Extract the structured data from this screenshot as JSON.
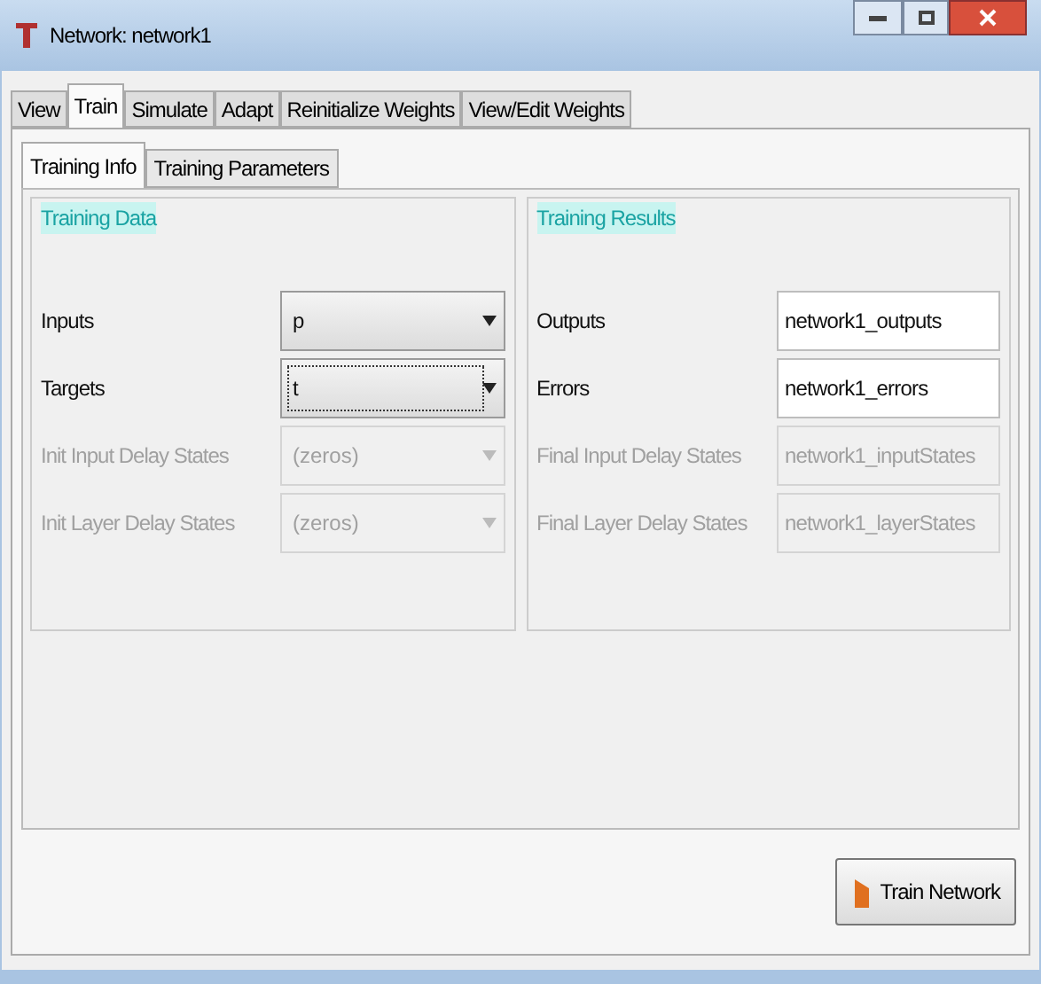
{
  "window": {
    "title": "Network: network1"
  },
  "tabs": [
    {
      "label": "View",
      "selected": false
    },
    {
      "label": "Train",
      "selected": true
    },
    {
      "label": "Simulate",
      "selected": false
    },
    {
      "label": "Adapt",
      "selected": false
    },
    {
      "label": "Reinitialize Weights",
      "selected": false
    },
    {
      "label": "View/Edit Weights",
      "selected": false
    }
  ],
  "subtabs": [
    {
      "label": "Training Info",
      "selected": true
    },
    {
      "label": "Training Parameters",
      "selected": false
    }
  ],
  "groups": [
    {
      "title": "Training Data",
      "fields": [
        {
          "label": "Inputs",
          "kind": "combo",
          "value": "p",
          "disabled": false,
          "focused": false
        },
        {
          "label": "Targets",
          "kind": "combo",
          "value": "t",
          "disabled": false,
          "focused": true
        },
        {
          "label": "Init Input Delay States",
          "kind": "combo",
          "value": "(zeros)",
          "disabled": true,
          "focused": false
        },
        {
          "label": "Init Layer Delay States",
          "kind": "combo",
          "value": "(zeros)",
          "disabled": true,
          "focused": false
        }
      ]
    },
    {
      "title": "Training Results",
      "fields": [
        {
          "label": "Outputs",
          "kind": "text",
          "value": "network1_outputs",
          "disabled": false,
          "focused": false
        },
        {
          "label": "Errors",
          "kind": "text",
          "value": "network1_errors",
          "disabled": false,
          "focused": false
        },
        {
          "label": "Final Input Delay States",
          "kind": "text",
          "value": "network1_inputStates",
          "disabled": true,
          "focused": false
        },
        {
          "label": "Final Layer Delay States",
          "kind": "text",
          "value": "network1_layerStates",
          "disabled": true,
          "focused": false
        }
      ]
    }
  ],
  "train_button": {
    "label": "Train Network"
  }
}
